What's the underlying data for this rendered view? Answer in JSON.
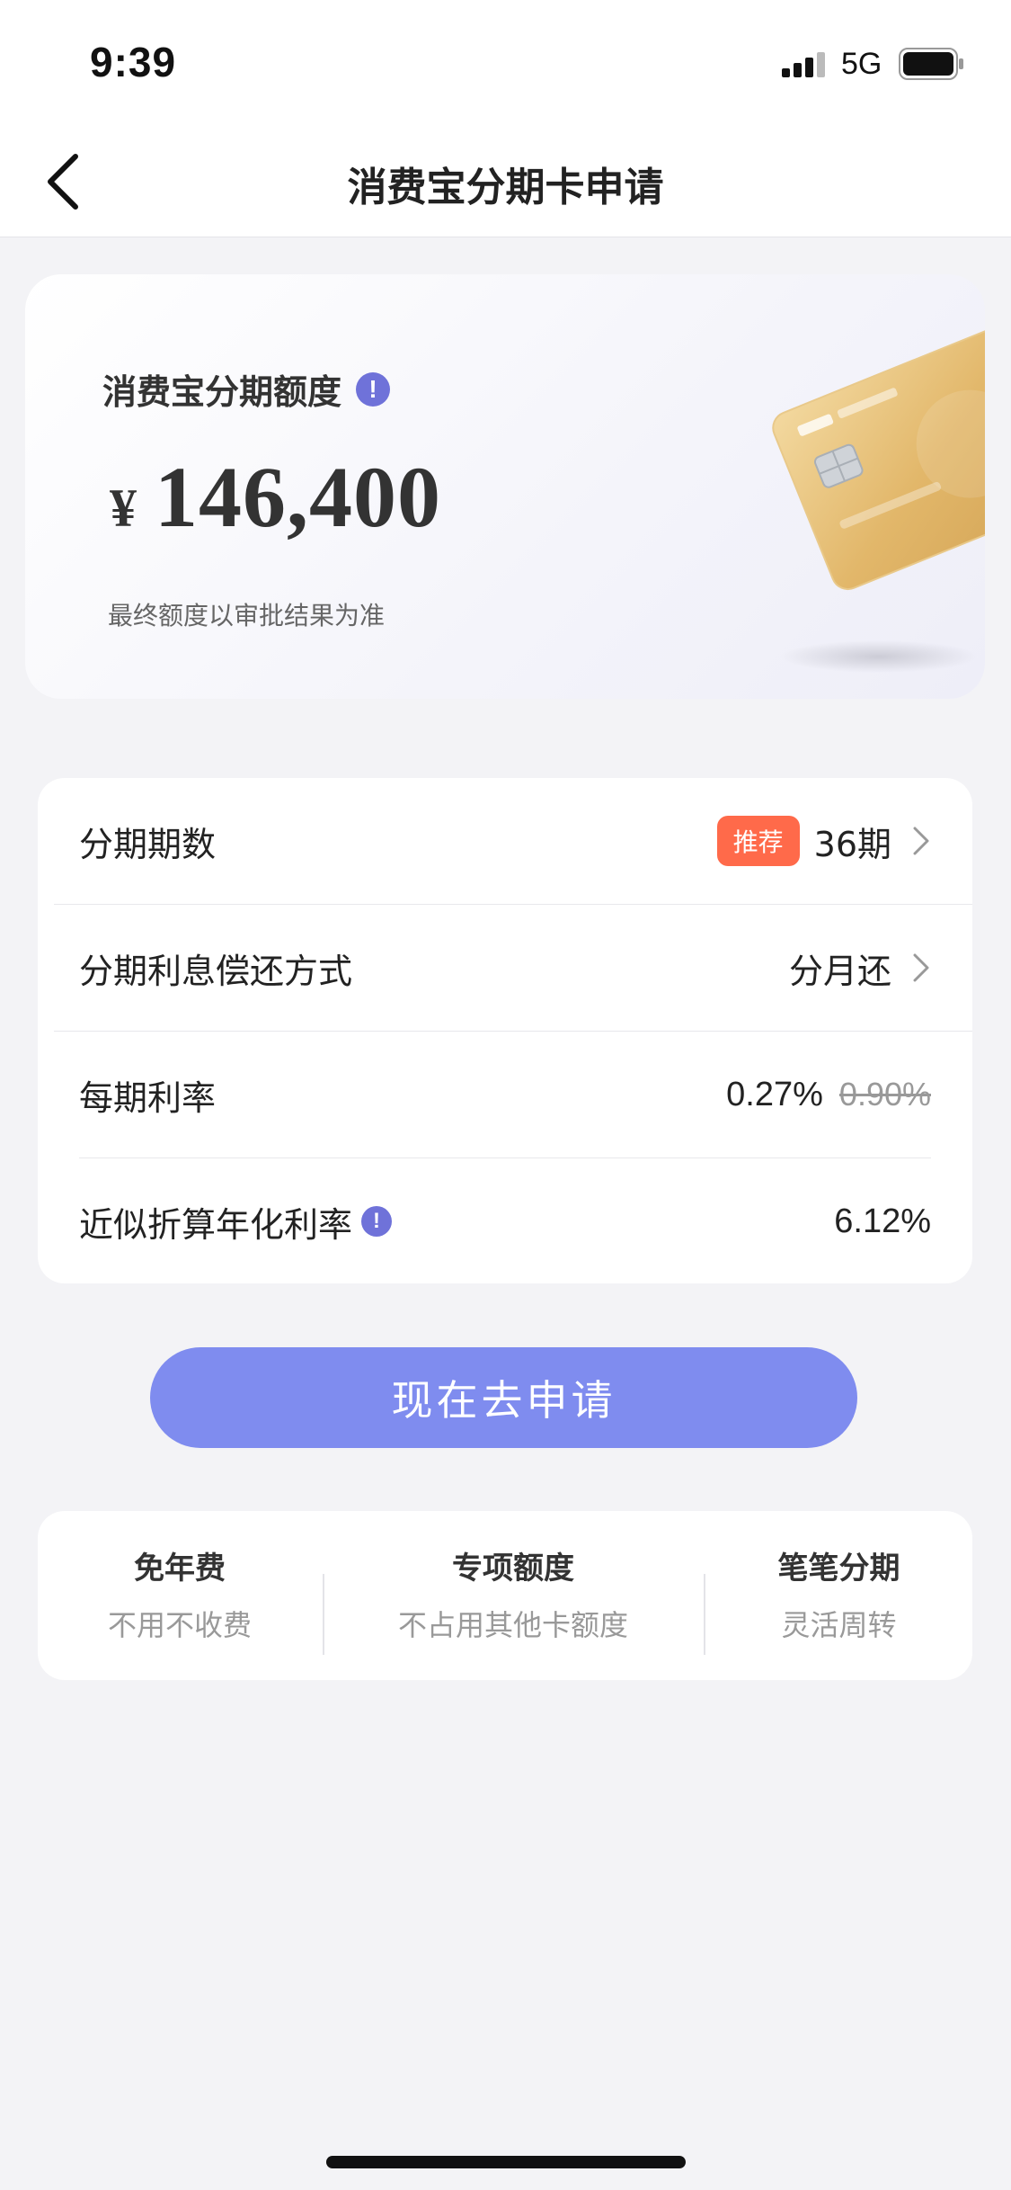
{
  "status_bar": {
    "time": "9:39",
    "network": "5G"
  },
  "nav": {
    "title": "消费宝分期卡申请",
    "back_icon": "chevron-left-icon"
  },
  "limit": {
    "title": "消费宝分期额度",
    "currency": "¥",
    "amount": "146,400",
    "note": "最终额度以审批结果为准",
    "info_icon": "info-icon"
  },
  "options": [
    {
      "label": "分期期数",
      "badge": "推荐",
      "value": "36期",
      "has_chevron": true
    },
    {
      "label": "分期利息偿还方式",
      "value": "分月还",
      "has_chevron": true
    },
    {
      "label": "每期利率",
      "value": "0.27%",
      "old_value": "0.90%"
    },
    {
      "label": "近似折算年化利率",
      "value": "6.12%",
      "has_info": true
    }
  ],
  "apply_button": {
    "label": "现在去申请"
  },
  "benefits": [
    {
      "title": "免年费",
      "subtitle": "不用不收费"
    },
    {
      "title": "专项额度",
      "subtitle": "不占用其他卡额度"
    },
    {
      "title": "笔笔分期",
      "subtitle": "灵活周转"
    }
  ],
  "colors": {
    "accent": "#7f8cef",
    "info": "#6f72d9",
    "badge": "#ff6a4a",
    "background": "#f3f3f6"
  }
}
